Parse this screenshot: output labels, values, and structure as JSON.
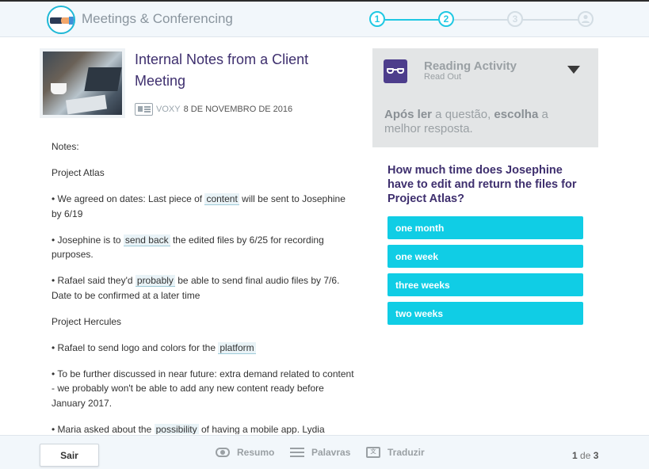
{
  "header": {
    "app_title": "Meetings & Conferencing",
    "logo_icon": "handshake-icon",
    "steps": [
      {
        "label": "1",
        "state": "done"
      },
      {
        "label": "2",
        "state": "current"
      },
      {
        "label": "3",
        "state": "todo"
      },
      {
        "label": "",
        "state": "todo",
        "icon": "user-icon"
      }
    ]
  },
  "article": {
    "title": "Internal Notes from a Client Meeting",
    "source_icon": "newspaper-icon",
    "source": "VOXY",
    "date": "8 DE NOVEMBRO DE 2016",
    "paragraphs": [
      [
        "Notes:"
      ],
      [
        "Project Atlas"
      ],
      [
        "• We agreed on dates: Last piece of ",
        {
          "vocab": "content"
        },
        " will be sent to Josephine by 6/19"
      ],
      [
        "• Josephine is to ",
        {
          "vocab": "send back"
        },
        " the edited files by 6/25 for recording purposes."
      ],
      [
        "• Rafael said they'd ",
        {
          "vocab": "probably"
        },
        " be able to send final audio files by 7/6. Date to be confirmed at a later time"
      ],
      [
        "Project Hercules"
      ],
      [
        "• Rafael to send logo and colors for the ",
        {
          "vocab": "platform"
        }
      ],
      [
        "• To be further discussed in near future: extra demand related to content - we probably won't be able to add any new content ready before January 2017."
      ],
      [
        "• Maria asked about the ",
        {
          "vocab": "possibility"
        },
        " of having a mobile app. Lydia"
      ]
    ]
  },
  "activity": {
    "icon": "glasses-icon",
    "title": "Reading Activity",
    "subtitle": "Read Out",
    "instruction_parts": [
      {
        "text": "Após ler",
        "bold": true
      },
      {
        "text": " a questão, ",
        "bold": false
      },
      {
        "text": "escolha",
        "bold": true
      },
      {
        "text": " a melhor resposta.",
        "bold": false
      }
    ],
    "question": "How much time does Josephine have to edit and return the files for Project Atlas?",
    "options": [
      "one month",
      "one week",
      "three weeks",
      "two weeks"
    ]
  },
  "footer": {
    "exit_label": "Sair",
    "tools": [
      {
        "label": "Resumo",
        "icon": "eye-icon"
      },
      {
        "label": "Palavras",
        "icon": "list-icon"
      },
      {
        "label": "Traduzir",
        "icon": "translate-icon"
      }
    ],
    "pager": {
      "current": "1",
      "sep": "de",
      "total": "3"
    }
  },
  "colors": {
    "accent": "#10cde5",
    "title": "#3e2f6e",
    "panel": "#e3e5e6",
    "header_bg": "#f2f7fb"
  }
}
